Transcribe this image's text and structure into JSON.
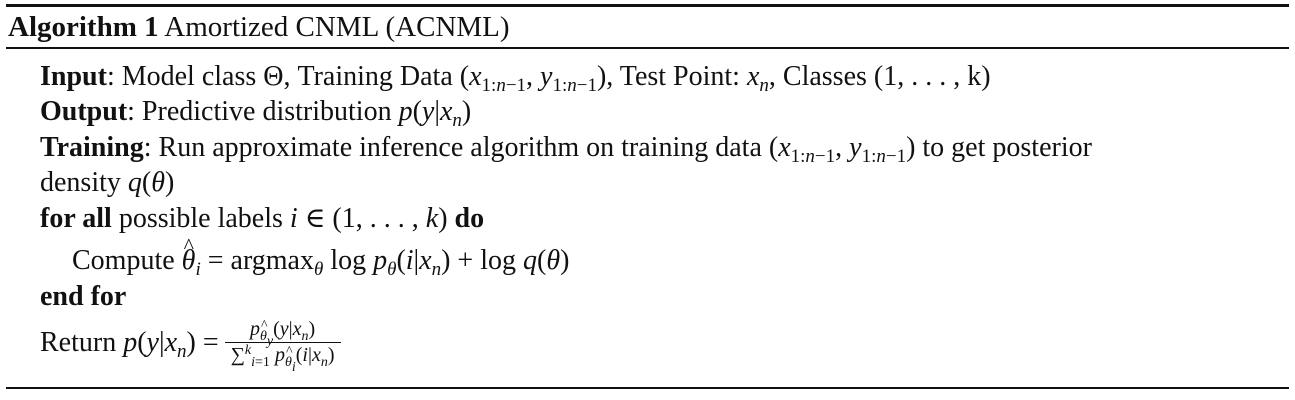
{
  "algorithm": {
    "label": "Algorithm 1",
    "title": "Amortized CNML (ACNML)"
  },
  "lines": {
    "input_kw": "Input",
    "input_text": ": Model class Θ, Training Data ",
    "input_test": ", Test Point: ",
    "input_classes": ", Classes (1, . . . , k)",
    "output_kw": "Output",
    "output_text": ": Predictive distribution ",
    "training_kw": "Training",
    "training_text": ": Run approximate inference algorithm on training data ",
    "training_tail": " to get posterior",
    "density_text": "density ",
    "for_kw": "for all",
    "for_text": " possible labels ",
    "do_kw": "do",
    "compute_text": "Compute ",
    "argmax_text": "argmax",
    "log_text": "log",
    "endfor_kw": "end for",
    "return_text": "Return "
  }
}
